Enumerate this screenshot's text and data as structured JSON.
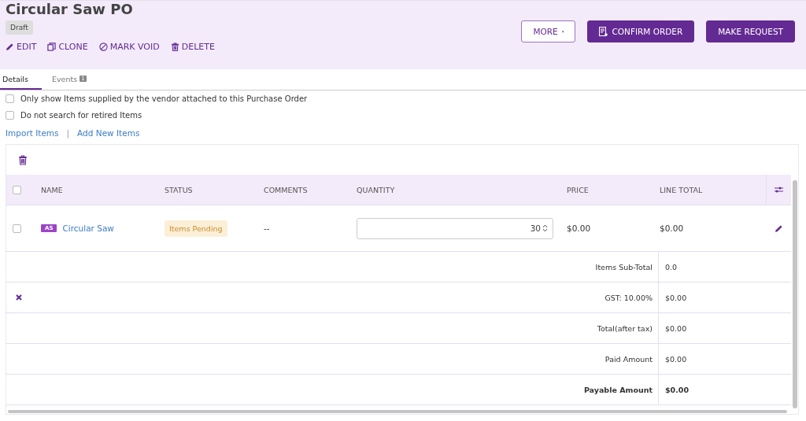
{
  "header": {
    "title": "Circular Saw PO",
    "status_badge": "Draft",
    "actions": [
      {
        "kind": "edit",
        "label": "EDIT"
      },
      {
        "kind": "clone",
        "label": "CLONE"
      },
      {
        "kind": "void",
        "label": "MARK VOID"
      },
      {
        "kind": "delete",
        "label": "DELETE"
      }
    ],
    "buttons": [
      {
        "kind": "outline",
        "label": "MORE"
      },
      {
        "kind": "confirm",
        "label": "CONFIRM ORDER"
      },
      {
        "kind": "primary",
        "label": "MAKE REQUEST"
      }
    ]
  },
  "tabs": [
    {
      "label": "Details",
      "selected": true
    },
    {
      "label": "Events",
      "count": "1",
      "selected": false
    }
  ],
  "options": [
    {
      "label": "Only show Items supplied by the vendor attached to this Purchase Order",
      "checked": false
    },
    {
      "label": "Do not search for retired Items",
      "checked": false
    }
  ],
  "links": [
    "Import Items",
    "Add New Items"
  ],
  "link_separator": "|",
  "table": {
    "select_all_checked": false,
    "columns": [
      "NAME",
      "STATUS",
      "COMMENTS",
      "QUANTITY",
      "PRICE",
      "LINE TOTAL"
    ],
    "rows": [
      {
        "checked": false,
        "tag": "AS",
        "name": "Circular Saw",
        "status": "Items Pending",
        "comments": "--",
        "quantity": "30",
        "price": "$0.00",
        "line_total": "$0.00"
      }
    ],
    "summary": [
      {
        "label": "Items Sub-Total",
        "value": "0.0",
        "bold": false,
        "removable": false
      },
      {
        "label": "GST: 10.00%",
        "value": "$0.00",
        "bold": false,
        "removable": true
      },
      {
        "label": "Total(after tax)",
        "value": "$0.00",
        "bold": false,
        "removable": false
      },
      {
        "label": "Paid Amount",
        "value": "$0.00",
        "bold": false,
        "removable": false
      },
      {
        "label": "Payable Amount",
        "value": "$0.00",
        "bold": true,
        "removable": false
      }
    ]
  }
}
